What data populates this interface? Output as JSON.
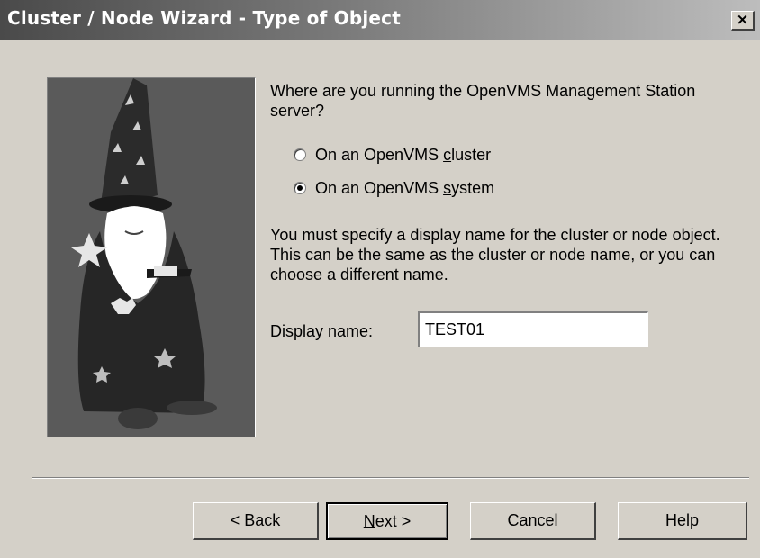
{
  "window": {
    "title": "Cluster / Node Wizard - Type of Object",
    "close_glyph": "×"
  },
  "wizard_image": {
    "icon": "wizard-illustration"
  },
  "question": {
    "text": "Where are you running the OpenVMS Management Station server?"
  },
  "radios": [
    {
      "pre": "On an OpenVMS ",
      "mnemonic": "c",
      "post": "luster",
      "selected": false
    },
    {
      "pre": "On an OpenVMS ",
      "mnemonic": "s",
      "post": "ystem",
      "selected": true
    }
  ],
  "info": {
    "text": "You must specify a display name for the cluster or node object.  This can be the same as the cluster or node name, or you can choose a different name."
  },
  "display_name": {
    "label_mnemonic": "D",
    "label_rest": "isplay name:",
    "value": "TEST01"
  },
  "buttons": {
    "back_pre": "< ",
    "back_mnemonic": "B",
    "back_post": "ack",
    "next_mnemonic": "N",
    "next_post": "ext >",
    "cancel": "Cancel",
    "help": "Help"
  }
}
